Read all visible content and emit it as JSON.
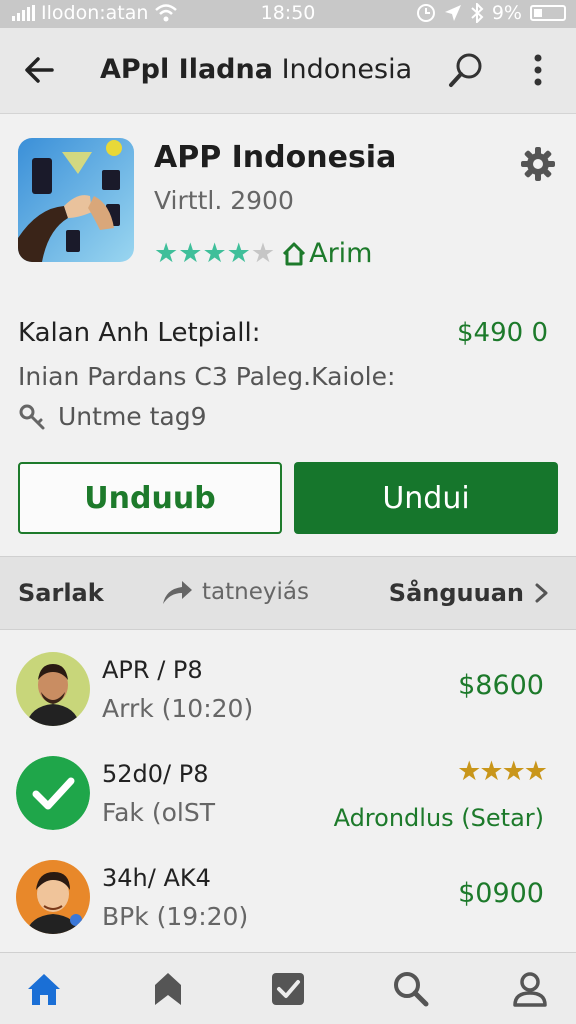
{
  "status_bar": {
    "carrier": "Ilodon:atan",
    "time": "18:50",
    "battery": "9%"
  },
  "app_bar": {
    "title_bold": "APpl Iladna",
    "title_rest": "Indonesia"
  },
  "app": {
    "name": "APP Indonesia",
    "version": "Virttl. 2900",
    "rating": 4,
    "rating_max": 5,
    "rating_label": "Arim",
    "info_label": "Kalan Anh Letpiall:",
    "info_price": "$490 0",
    "info_line2": "Inian Pardans C3  Paleg.Kaiole:",
    "tag_text": "Untme tag9",
    "button_outline": "Unduub",
    "button_primary": "Undui"
  },
  "tabs": {
    "left": "Sarlak",
    "middle": "tatneyiás",
    "right": "Sånguuan"
  },
  "list": [
    {
      "title": "APR / P8",
      "subtitle": "Arrk  (10:20)",
      "amount": "$8600",
      "avatar": "man-beard"
    },
    {
      "title": "52d0/ P8",
      "subtitle": "Fak  (olST",
      "stars": "★★★★",
      "status": "Adrondlus (Setar)",
      "avatar": "green-check"
    },
    {
      "title": "34h/ AK4",
      "subtitle": "BPk  (19:20)",
      "amount": "$0900",
      "avatar": "man-orange"
    }
  ],
  "colors": {
    "accent_green": "#16762c",
    "text_green": "#1d7a2b",
    "star_teal": "#3fbf9a",
    "nav_blue": "#1a6fd6"
  }
}
